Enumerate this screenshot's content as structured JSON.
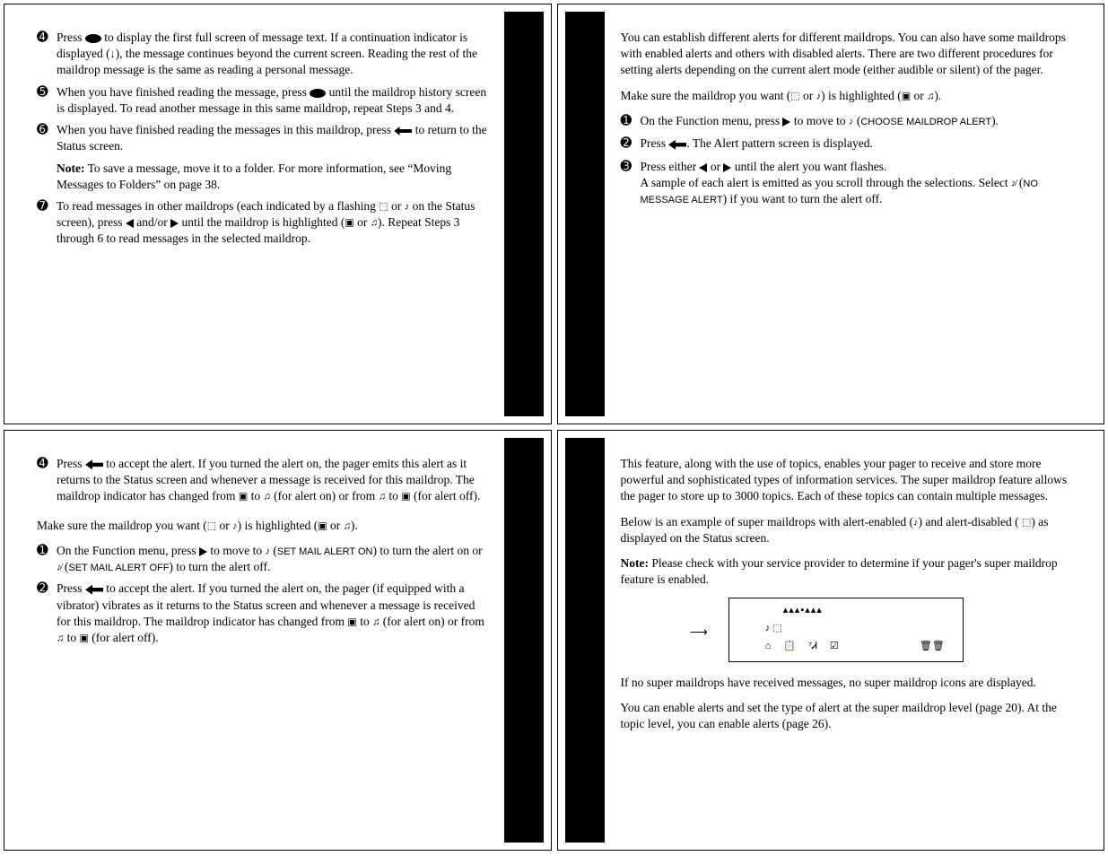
{
  "page_tl": {
    "item4": "Press   to display the first full screen of message text. If a continuation indicator is displayed (↓), the message continues beyond the current screen. Reading the rest of the maildrop message is the same as reading a personal message.",
    "item5": "When you have finished reading the message, press   until the maildrop history screen is displayed. To read another message in this same maildrop, repeat Steps 3 and 4.",
    "item6": "When you have finished reading the messages in this maildrop, press   to return to the Status screen.",
    "note": "To save a message, move it to a folder. For more information, see “Moving Messages to Folders” on page 38.",
    "item7": "To read messages in other maildrops (each indicated by a flashing   or   on the Status screen), press   and/or   until the maildrop is highlighted (  or  ). Repeat Steps 3 through 6 to read messages in the selected maildrop."
  },
  "page_tr": {
    "p1": "You can establish different alerts for different maildrops. You can also have some maildrops with enabled alerts and others with disabled alerts. There are two different procedures for setting alerts depending on the current alert mode (either audible or silent) of the pager.",
    "p2": "Make sure the maildrop you want (  or  ) is highlighted (  or  ).",
    "item1": "On the Function menu, press   to move to   (CHOOSE MAILDROP ALERT).",
    "item2": "Press  . The Alert pattern screen is displayed.",
    "item3": "Press either   or   until the alert you want flashes.",
    "item3b": "A sample of each alert is emitted as you scroll through the selections. Select   (NO MESSAGE ALERT) if you want to turn the alert off."
  },
  "page_bl": {
    "item4": "Press   to accept the alert. If you turned the alert on, the pager emits this alert as it returns to the Status screen and whenever a message is received for this maildrop. The maildrop indicator has changed from   to   (for alert on) or from   to   (for alert off).",
    "p2": "Make sure the maildrop you want (  or  ) is highlighted (  or  ).",
    "item1": "On the Function menu, press   to move to   (SET MAIL ALERT ON) to turn the alert on or   (SET MAIL ALERT OFF) to turn the alert off.",
    "item2": "Press   to accept the alert. If you turned the alert on, the pager (if equipped with a vibrator) vibrates as it returns to the Status screen and whenever a message is received for this maildrop. The maildrop indicator has changed from   to   (for alert on) or from   to   (for alert off)."
  },
  "page_br": {
    "p1": "This feature, along with the use of topics, enables your pager to receive and store more powerful and sophisticated types of information services. The super maildrop feature allows the pager to store up to 3000 topics. Each of these topics can contain multiple messages.",
    "p2": "Below is an example of super maildrops with alert-enabled ( ) and alert-disabled (  ) as displayed on the Status screen.",
    "note": "Please check with your service provider to determine if your pager's super maildrop feature is enabled.",
    "p3": "If no super maildrops have received messages, no super maildrop icons are displayed.",
    "p4": "You can enable alerts and set the type of alert at the super maildrop level (page 20). At the topic level, you can enable alerts (page 26)."
  },
  "labels": {
    "note": "Note:",
    "choose_maildrop": "CHOOSE MAILDROP ALERT",
    "no_msg_alert": "NO MESSAGE ALERT",
    "set_on": "SET MAIL ALERT ON",
    "set_off": "SET MAIL ALERT OFF"
  },
  "bullets": {
    "n1": "➊",
    "n2": "➋",
    "n3": "➌",
    "n4": "➍",
    "n5": "➎",
    "n6": "➏",
    "n7": "➐"
  },
  "lcd": {
    "row1": "▴▴▴▪▴▴▴",
    "row2_a": "♪",
    "row2_b": "⬚",
    "row3": [
      "⌂",
      "📋",
      "⁷Ꮧ",
      "☑",
      "",
      "🗑🗑"
    ]
  }
}
